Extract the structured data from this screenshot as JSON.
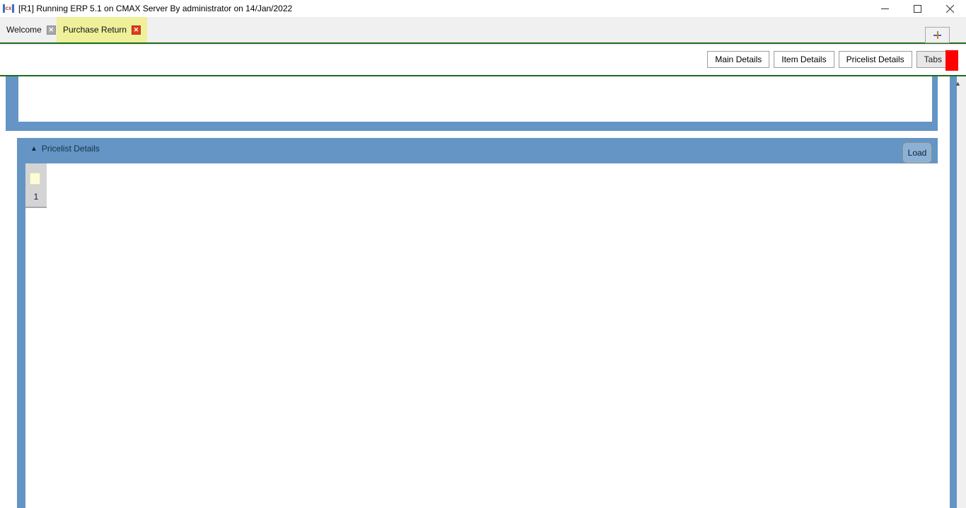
{
  "window": {
    "title": "[R1] Running ERP 5.1 on CMAX Server By administrator on 14/Jan/2022",
    "icon": "cx-app-icon",
    "controls": {
      "minimize": "minimize-icon",
      "maximize": "maximize-icon",
      "close": "close-icon"
    }
  },
  "tabs": {
    "items": [
      {
        "label": "Welcome",
        "active": false,
        "close_icon": "close-icon"
      },
      {
        "label": "Purchase Return",
        "active": true,
        "close_icon": "close-icon"
      }
    ],
    "new_tab_icon": "plus-icon"
  },
  "toolbar": {
    "buttons": [
      {
        "label": "Main Details",
        "disabled": false
      },
      {
        "label": "Item Details",
        "disabled": false
      },
      {
        "label": "Pricelist Details",
        "disabled": false
      },
      {
        "label": "Tabs",
        "disabled": true
      }
    ]
  },
  "top_panel": {
    "hscrollbar": {
      "left_arrow": "chevron-left-icon",
      "right_arrow": "chevron-right-icon"
    }
  },
  "pricelist_panel": {
    "caret": "▲",
    "title": "Pricelist Details",
    "load_label": "Load",
    "grid": {
      "row_numbers": [
        "1"
      ],
      "selected_cell": ""
    }
  },
  "vscrollbar": {
    "up_arrow": "chevron-up-icon"
  },
  "colors": {
    "panel_blue": "#6495c4",
    "active_tab": "#eff09a",
    "green_rule": "#1d6b1d",
    "red_marker": "#fe0000",
    "grid_header": "#d4d4d4",
    "yellow_cell": "#fcfcd7"
  }
}
